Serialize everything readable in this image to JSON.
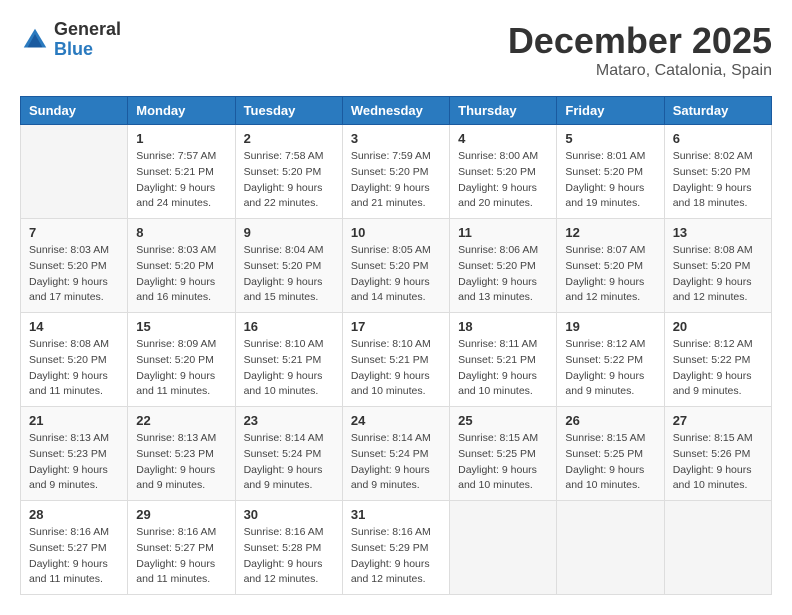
{
  "logo": {
    "general": "General",
    "blue": "Blue"
  },
  "header": {
    "month": "December 2025",
    "location": "Mataro, Catalonia, Spain"
  },
  "weekdays": [
    "Sunday",
    "Monday",
    "Tuesday",
    "Wednesday",
    "Thursday",
    "Friday",
    "Saturday"
  ],
  "weeks": [
    [
      {
        "day": "",
        "info": ""
      },
      {
        "day": "1",
        "info": "Sunrise: 7:57 AM\nSunset: 5:21 PM\nDaylight: 9 hours\nand 24 minutes."
      },
      {
        "day": "2",
        "info": "Sunrise: 7:58 AM\nSunset: 5:20 PM\nDaylight: 9 hours\nand 22 minutes."
      },
      {
        "day": "3",
        "info": "Sunrise: 7:59 AM\nSunset: 5:20 PM\nDaylight: 9 hours\nand 21 minutes."
      },
      {
        "day": "4",
        "info": "Sunrise: 8:00 AM\nSunset: 5:20 PM\nDaylight: 9 hours\nand 20 minutes."
      },
      {
        "day": "5",
        "info": "Sunrise: 8:01 AM\nSunset: 5:20 PM\nDaylight: 9 hours\nand 19 minutes."
      },
      {
        "day": "6",
        "info": "Sunrise: 8:02 AM\nSunset: 5:20 PM\nDaylight: 9 hours\nand 18 minutes."
      }
    ],
    [
      {
        "day": "7",
        "info": "Sunrise: 8:03 AM\nSunset: 5:20 PM\nDaylight: 9 hours\nand 17 minutes."
      },
      {
        "day": "8",
        "info": "Sunrise: 8:03 AM\nSunset: 5:20 PM\nDaylight: 9 hours\nand 16 minutes."
      },
      {
        "day": "9",
        "info": "Sunrise: 8:04 AM\nSunset: 5:20 PM\nDaylight: 9 hours\nand 15 minutes."
      },
      {
        "day": "10",
        "info": "Sunrise: 8:05 AM\nSunset: 5:20 PM\nDaylight: 9 hours\nand 14 minutes."
      },
      {
        "day": "11",
        "info": "Sunrise: 8:06 AM\nSunset: 5:20 PM\nDaylight: 9 hours\nand 13 minutes."
      },
      {
        "day": "12",
        "info": "Sunrise: 8:07 AM\nSunset: 5:20 PM\nDaylight: 9 hours\nand 12 minutes."
      },
      {
        "day": "13",
        "info": "Sunrise: 8:08 AM\nSunset: 5:20 PM\nDaylight: 9 hours\nand 12 minutes."
      }
    ],
    [
      {
        "day": "14",
        "info": "Sunrise: 8:08 AM\nSunset: 5:20 PM\nDaylight: 9 hours\nand 11 minutes."
      },
      {
        "day": "15",
        "info": "Sunrise: 8:09 AM\nSunset: 5:20 PM\nDaylight: 9 hours\nand 11 minutes."
      },
      {
        "day": "16",
        "info": "Sunrise: 8:10 AM\nSunset: 5:21 PM\nDaylight: 9 hours\nand 10 minutes."
      },
      {
        "day": "17",
        "info": "Sunrise: 8:10 AM\nSunset: 5:21 PM\nDaylight: 9 hours\nand 10 minutes."
      },
      {
        "day": "18",
        "info": "Sunrise: 8:11 AM\nSunset: 5:21 PM\nDaylight: 9 hours\nand 10 minutes."
      },
      {
        "day": "19",
        "info": "Sunrise: 8:12 AM\nSunset: 5:22 PM\nDaylight: 9 hours\nand 9 minutes."
      },
      {
        "day": "20",
        "info": "Sunrise: 8:12 AM\nSunset: 5:22 PM\nDaylight: 9 hours\nand 9 minutes."
      }
    ],
    [
      {
        "day": "21",
        "info": "Sunrise: 8:13 AM\nSunset: 5:23 PM\nDaylight: 9 hours\nand 9 minutes."
      },
      {
        "day": "22",
        "info": "Sunrise: 8:13 AM\nSunset: 5:23 PM\nDaylight: 9 hours\nand 9 minutes."
      },
      {
        "day": "23",
        "info": "Sunrise: 8:14 AM\nSunset: 5:24 PM\nDaylight: 9 hours\nand 9 minutes."
      },
      {
        "day": "24",
        "info": "Sunrise: 8:14 AM\nSunset: 5:24 PM\nDaylight: 9 hours\nand 9 minutes."
      },
      {
        "day": "25",
        "info": "Sunrise: 8:15 AM\nSunset: 5:25 PM\nDaylight: 9 hours\nand 10 minutes."
      },
      {
        "day": "26",
        "info": "Sunrise: 8:15 AM\nSunset: 5:25 PM\nDaylight: 9 hours\nand 10 minutes."
      },
      {
        "day": "27",
        "info": "Sunrise: 8:15 AM\nSunset: 5:26 PM\nDaylight: 9 hours\nand 10 minutes."
      }
    ],
    [
      {
        "day": "28",
        "info": "Sunrise: 8:16 AM\nSunset: 5:27 PM\nDaylight: 9 hours\nand 11 minutes."
      },
      {
        "day": "29",
        "info": "Sunrise: 8:16 AM\nSunset: 5:27 PM\nDaylight: 9 hours\nand 11 minutes."
      },
      {
        "day": "30",
        "info": "Sunrise: 8:16 AM\nSunset: 5:28 PM\nDaylight: 9 hours\nand 12 minutes."
      },
      {
        "day": "31",
        "info": "Sunrise: 8:16 AM\nSunset: 5:29 PM\nDaylight: 9 hours\nand 12 minutes."
      },
      {
        "day": "",
        "info": ""
      },
      {
        "day": "",
        "info": ""
      },
      {
        "day": "",
        "info": ""
      }
    ]
  ]
}
